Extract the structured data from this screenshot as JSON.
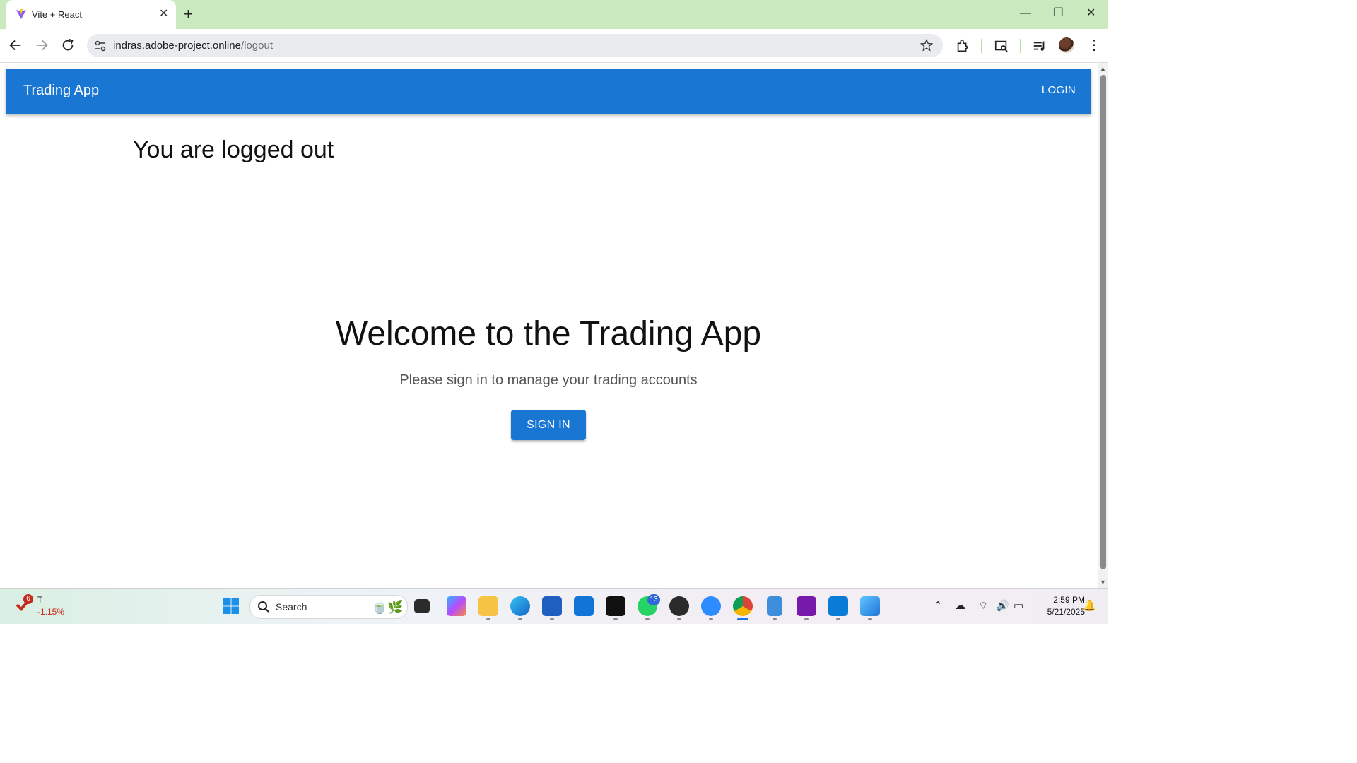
{
  "browser": {
    "tab_title": "Vite + React",
    "url_host": "indras.adobe-project.online",
    "url_path": "/logout"
  },
  "appbar": {
    "brand": "Trading App",
    "login_label": "LOGIN"
  },
  "page": {
    "logged_out_text": "You are logged out",
    "welcome_heading": "Welcome to the Trading App",
    "subtitle": "Please sign in to manage your trading accounts",
    "signin_label": "SIGN IN"
  },
  "colors": {
    "primary": "#1976d2",
    "tabbar": "#cbe9bf"
  },
  "taskbar": {
    "stock_badge": "6",
    "stock_symbol": "T",
    "stock_change": "-1.15%",
    "search_placeholder": "Search",
    "whatsapp_badge": "13",
    "clock_time": "2:59 PM",
    "clock_date": "5/21/2025",
    "apps": [
      "task-view",
      "copilot",
      "file-explorer",
      "edge",
      "store",
      "outlook",
      "intellij",
      "whatsapp",
      "media-player",
      "zoom",
      "chrome",
      "notepad",
      "onenote",
      "vscode",
      "photos"
    ]
  }
}
